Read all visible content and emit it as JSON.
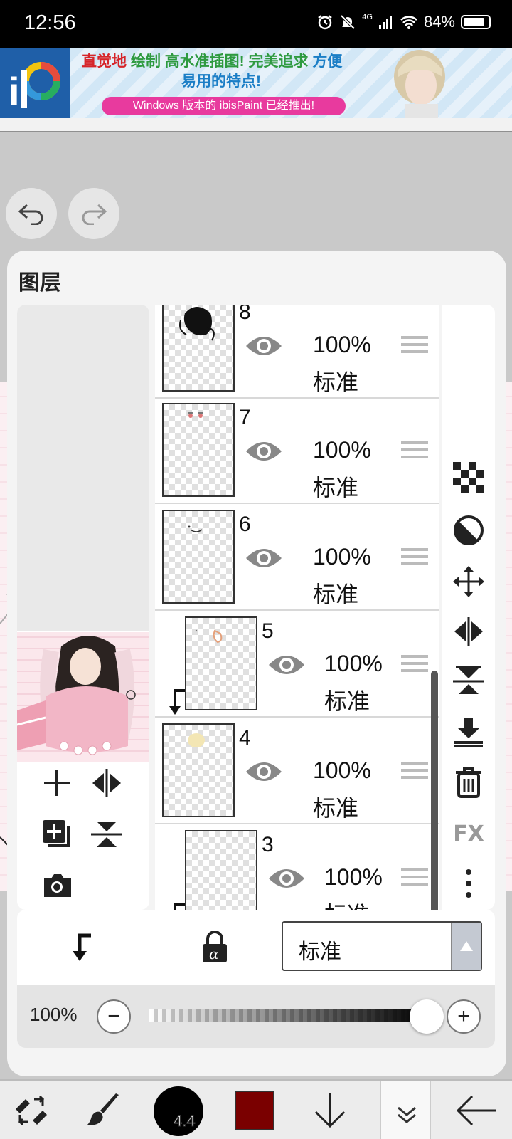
{
  "status_bar": {
    "time": "12:56",
    "network": "4G",
    "battery": "84%"
  },
  "ad": {
    "line1_parts": [
      "直觉地",
      "绘制",
      "高水准插图!",
      "完美追求",
      "方便"
    ],
    "line1_colors": [
      "#d6252a",
      "#2e9a3f",
      "#2e9a3f",
      "#2e9a3f",
      "#1b7ec6"
    ],
    "line2": "易用的特点!",
    "pill": "Windows 版本的 ibisPaint 已经推出!"
  },
  "panel": {
    "title": "图层"
  },
  "layers": [
    {
      "number": "8",
      "opacity": "100%",
      "blend": "标准",
      "clipped": false
    },
    {
      "number": "7",
      "opacity": "100%",
      "blend": "标准",
      "clipped": false
    },
    {
      "number": "6",
      "opacity": "100%",
      "blend": "标准",
      "clipped": false
    },
    {
      "number": "5",
      "opacity": "100%",
      "blend": "标准",
      "clipped": true
    },
    {
      "number": "4",
      "opacity": "100%",
      "blend": "标准",
      "clipped": false
    },
    {
      "number": "3",
      "opacity": "100%",
      "blend": "标准",
      "clipped": true
    }
  ],
  "side_tools": {
    "fx": "FX"
  },
  "controls": {
    "blend_mode": "标准",
    "opacity_value": "100%",
    "opacity_level": 1.0,
    "minus": "−",
    "plus": "+"
  },
  "bottom_bar": {
    "brush_size": "4.4",
    "color": "#7a0000"
  }
}
